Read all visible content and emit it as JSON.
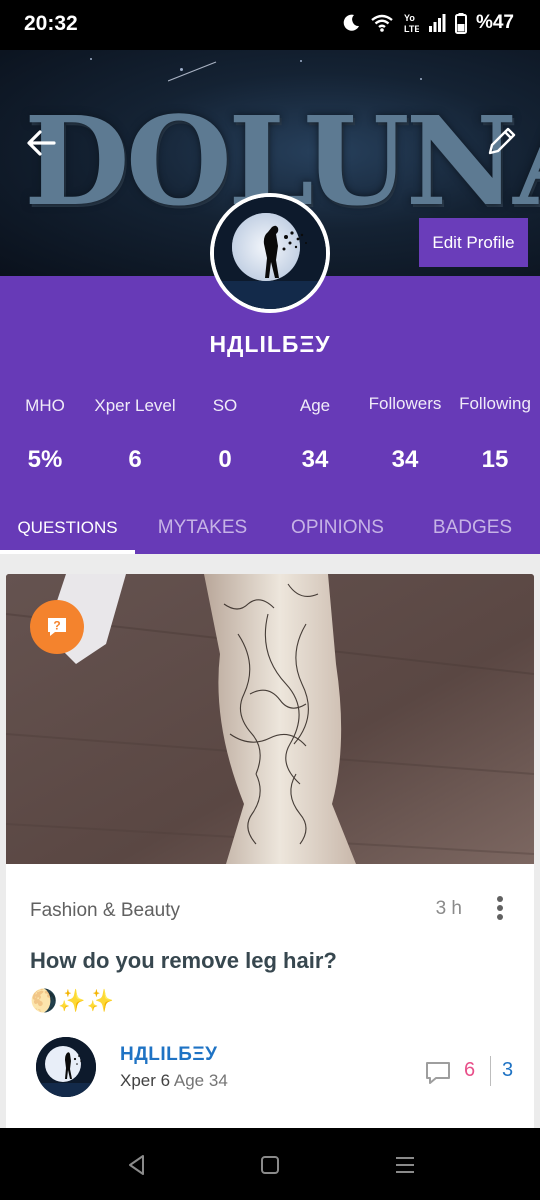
{
  "status_bar": {
    "time": "20:32",
    "battery": "%47",
    "icons": [
      "moon-icon",
      "wifi-icon",
      "volte-icon",
      "signal-icon",
      "battery-icon"
    ]
  },
  "banner": {
    "artwork_text": "DOLUNAY",
    "edit_profile_label": "Edit Profile"
  },
  "profile": {
    "username": "НДLILБΞУ",
    "stats": [
      {
        "label": "MHO",
        "value": "5%"
      },
      {
        "label": "Xper Level",
        "value": "6"
      },
      {
        "label": "SO",
        "value": "0"
      },
      {
        "label": "Age",
        "value": "34"
      },
      {
        "label": "Followers",
        "value": "34"
      },
      {
        "label": "Following",
        "value": "15"
      }
    ],
    "tabs": [
      {
        "label": "QUESTIONS",
        "active": true
      },
      {
        "label": "MYTAKES",
        "active": false
      },
      {
        "label": "OPINIONS",
        "active": false
      },
      {
        "label": "BADGES",
        "active": false
      }
    ]
  },
  "card": {
    "category": "Fashion & Beauty",
    "time_ago": "3 h",
    "title": "How do you remove leg hair?",
    "emojis": "🌖✨✨",
    "author": {
      "name": "НДLILБΞУ",
      "level": "Xper 6",
      "age": "Age 34"
    },
    "comments": "6",
    "votes": "3"
  },
  "colors": {
    "purple": "#673ab7",
    "edit_button": "#6a3dba",
    "question_badge": "#f4832d",
    "author_blue": "#1f73c4",
    "comment_pink": "#e8508a"
  }
}
